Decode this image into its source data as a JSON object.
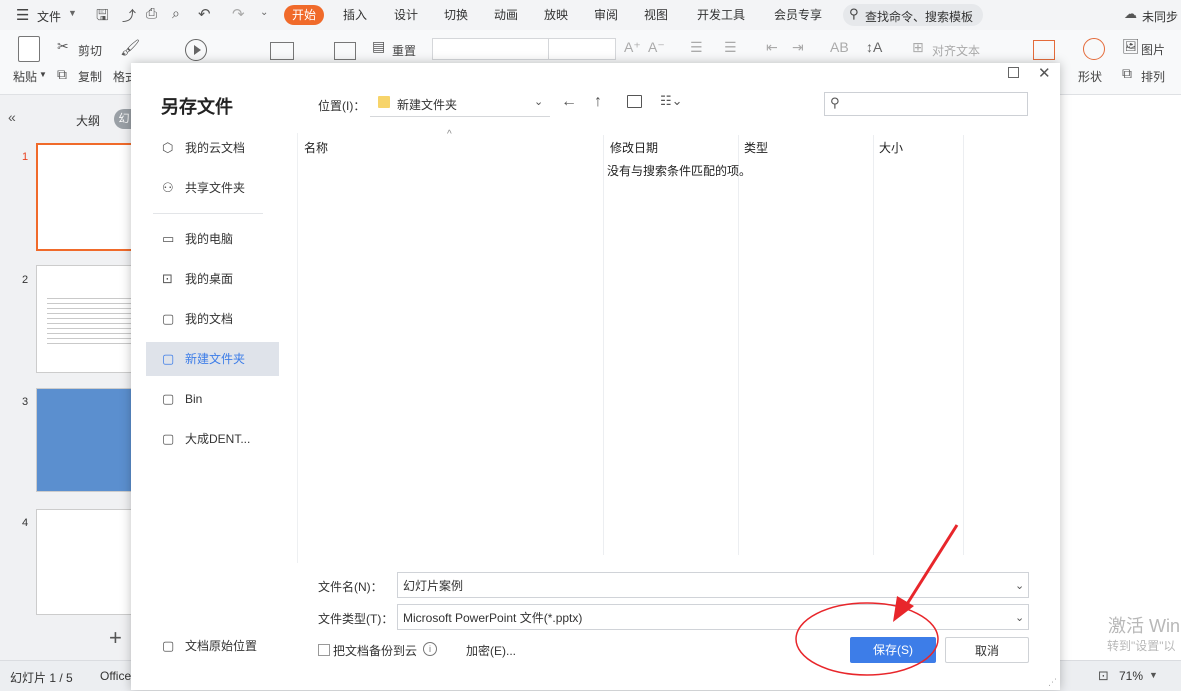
{
  "app": {
    "file_menu": "文件",
    "tabs": [
      "开始",
      "插入",
      "设计",
      "切换",
      "动画",
      "放映",
      "审阅",
      "视图",
      "开发工具",
      "会员专享"
    ],
    "active_tab": "开始",
    "search": "查找命令、搜索模板",
    "sync": "未同步"
  },
  "ribbon": {
    "paste": "粘贴",
    "cut": "剪切",
    "copy": "复制",
    "format": "格式",
    "reset": "重置",
    "align_text": "对齐文本",
    "picture": "图片",
    "shape": "形状",
    "arrange": "排列"
  },
  "left_panel": {
    "outline_tab": "大纲",
    "slide_tab": "幻",
    "slide_numbers": [
      "1",
      "2",
      "3",
      "4"
    ],
    "add": "+"
  },
  "status": {
    "slide_info": "幻灯片 1 / 5",
    "theme": "Office",
    "zoom": "71%"
  },
  "dialog": {
    "title": "另存文件",
    "nav": [
      {
        "icon": "cloud-cube-icon",
        "label": "我的云文档"
      },
      {
        "icon": "share-folder-icon",
        "label": "共享文件夹"
      },
      {
        "icon": "monitor-icon",
        "label": "我的电脑"
      },
      {
        "icon": "desktop-icon",
        "label": "我的桌面"
      },
      {
        "icon": "documents-icon",
        "label": "我的文档"
      },
      {
        "icon": "folder-icon",
        "label": "新建文件夹"
      },
      {
        "icon": "folder-icon",
        "label": "Bin"
      },
      {
        "icon": "folder-icon",
        "label": "大成DENT..."
      }
    ],
    "original_location": "文档原始位置",
    "location_label": "位置(I)：",
    "location_value": "新建文件夹",
    "columns": [
      "名称",
      "修改日期",
      "类型",
      "大小"
    ],
    "empty_message": "没有与搜索条件匹配的项。",
    "filename_label": "文件名(N)：",
    "filename_value": "幻灯片案例",
    "filetype_label": "文件类型(T)：",
    "filetype_value": "Microsoft PowerPoint 文件(*.pptx)",
    "backup_label": "把文档备份到云",
    "encrypt": "加密(E)...",
    "save": "保存(S)",
    "cancel": "取消"
  },
  "watermark": {
    "activate": "激活 Win",
    "activate_sub": "转到\"设置\"以"
  },
  "colors": {
    "accent": "#f06a2a",
    "primary_button": "#3d7de8",
    "annotation": "#e8262b"
  }
}
